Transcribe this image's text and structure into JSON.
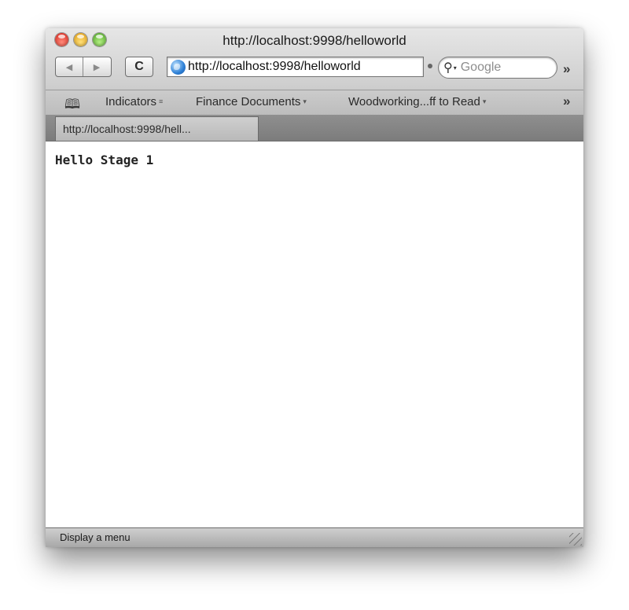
{
  "window": {
    "title": "http://localhost:9998/helloworld"
  },
  "toolbar": {
    "back_glyph": "◀",
    "forward_glyph": "▶",
    "reload_glyph": "C",
    "address": "http://localhost:9998/helloworld",
    "search_placeholder": "Google",
    "overflow_glyph": "»"
  },
  "bookmarks": {
    "items": [
      {
        "label": "Indicators",
        "mark": "≡"
      },
      {
        "label": "Finance Documents",
        "mark": "▾"
      },
      {
        "label": "Woodworking...ff to Read",
        "mark": "▾"
      }
    ],
    "overflow_glyph": "»"
  },
  "tabs": [
    {
      "label": "http://localhost:9998/hell..."
    }
  ],
  "page": {
    "text": "Hello Stage 1"
  },
  "status": {
    "text": "Display a menu"
  },
  "icons": {
    "close": "close-icon",
    "minimize": "minimize-icon",
    "zoom": "zoom-icon",
    "globe": "globe-icon",
    "search": "search-icon",
    "bookmarks": "book-icon",
    "resize": "resize-grip-icon"
  }
}
